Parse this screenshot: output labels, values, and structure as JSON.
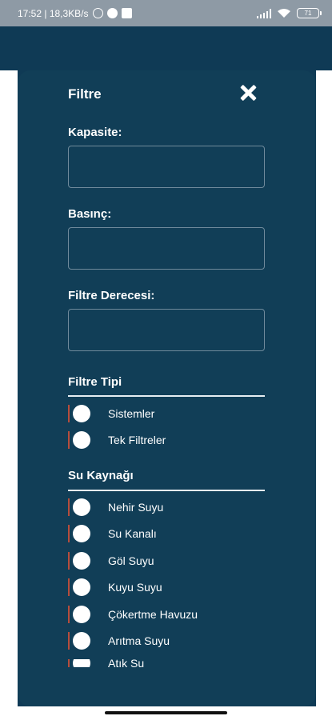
{
  "status_bar": {
    "time_speed": "17:52 | 18,3KB/s",
    "battery": "71"
  },
  "header": {
    "title": "Filtre",
    "close_icon": "close-icon"
  },
  "fields": [
    {
      "label": "Kapasite:",
      "value": "",
      "placeholder": ""
    },
    {
      "label": "Basınç:",
      "value": "",
      "placeholder": ""
    },
    {
      "label": "Filtre Derecesi:",
      "value": "",
      "placeholder": ""
    }
  ],
  "sections": {
    "filter_type": {
      "title": "Filtre Tipi",
      "options": [
        "Sistemler",
        "Tek Filtreler"
      ]
    },
    "water_source": {
      "title": "Su Kaynağı",
      "options": [
        "Nehir Suyu",
        "Su Kanalı",
        "Göl Suyu",
        "Kuyu Suyu",
        "Çökertme Havuzu",
        "Arıtma Suyu",
        "Atık Su"
      ]
    }
  },
  "colors": {
    "panel": "#113e57",
    "accent_bar": "#b74d3c"
  }
}
